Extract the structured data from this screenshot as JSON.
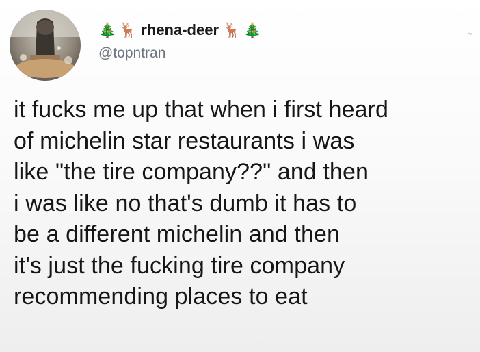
{
  "user": {
    "display_name": "rhena-deer",
    "handle": "@topntran",
    "name_emoji_left": [
      "🎄",
      "🦌"
    ],
    "name_emoji_right": [
      "🦌",
      "🎄"
    ]
  },
  "tweet": {
    "text": "it fucks me up that when i first heard\nof michelin star restaurants i was\nlike \"the tire company??\" and then\ni was like no that's dumb it has to\nbe a different michelin and then\nit's just the fucking tire company\nrecommending places to eat"
  },
  "icons": {
    "avatar": "profile-photo",
    "menu": "chevron-down-icon"
  },
  "colors": {
    "handle": "#6b7580",
    "text": "#161616"
  }
}
